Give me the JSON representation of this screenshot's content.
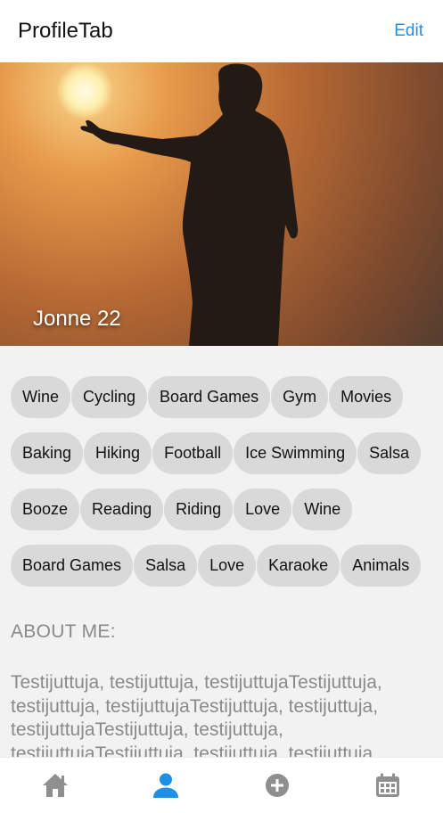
{
  "header": {
    "title": "ProfileTab",
    "edit_label": "Edit"
  },
  "profile": {
    "name_age": "Jonne 22"
  },
  "interests": {
    "rows": [
      [
        "Wine",
        "Cycling",
        "Board Games",
        "Gym",
        "Movies"
      ],
      [
        "Baking",
        "Hiking",
        "Football",
        "Ice Swimming",
        "Salsa"
      ],
      [
        "Booze",
        "Reading",
        "Riding",
        "Love",
        "Wine"
      ],
      [
        "Board Games",
        "Salsa",
        "Love",
        "Karaoke",
        "Animals"
      ]
    ]
  },
  "about": {
    "label": "ABOUT ME:",
    "text": "Testijuttuja, testijuttuja, testijuttujaTestijuttuja, testijuttuja, testijuttujaTestijuttuja, testijuttuja, testijuttujaTestijuttuja, testijuttuja, testijuttujaTestijuttuja, testijuttuja, testijuttuja"
  },
  "tabbar": {
    "items": [
      {
        "icon": "home-icon",
        "active": false
      },
      {
        "icon": "person-icon",
        "active": true
      },
      {
        "icon": "plus-circle-icon",
        "active": false
      },
      {
        "icon": "calendar-icon",
        "active": false
      }
    ],
    "active_color": "#1e90e6",
    "inactive_color": "#8f8f8f"
  },
  "colors": {
    "accent": "#1e90e6",
    "tag_bg": "#d9d9d9"
  }
}
